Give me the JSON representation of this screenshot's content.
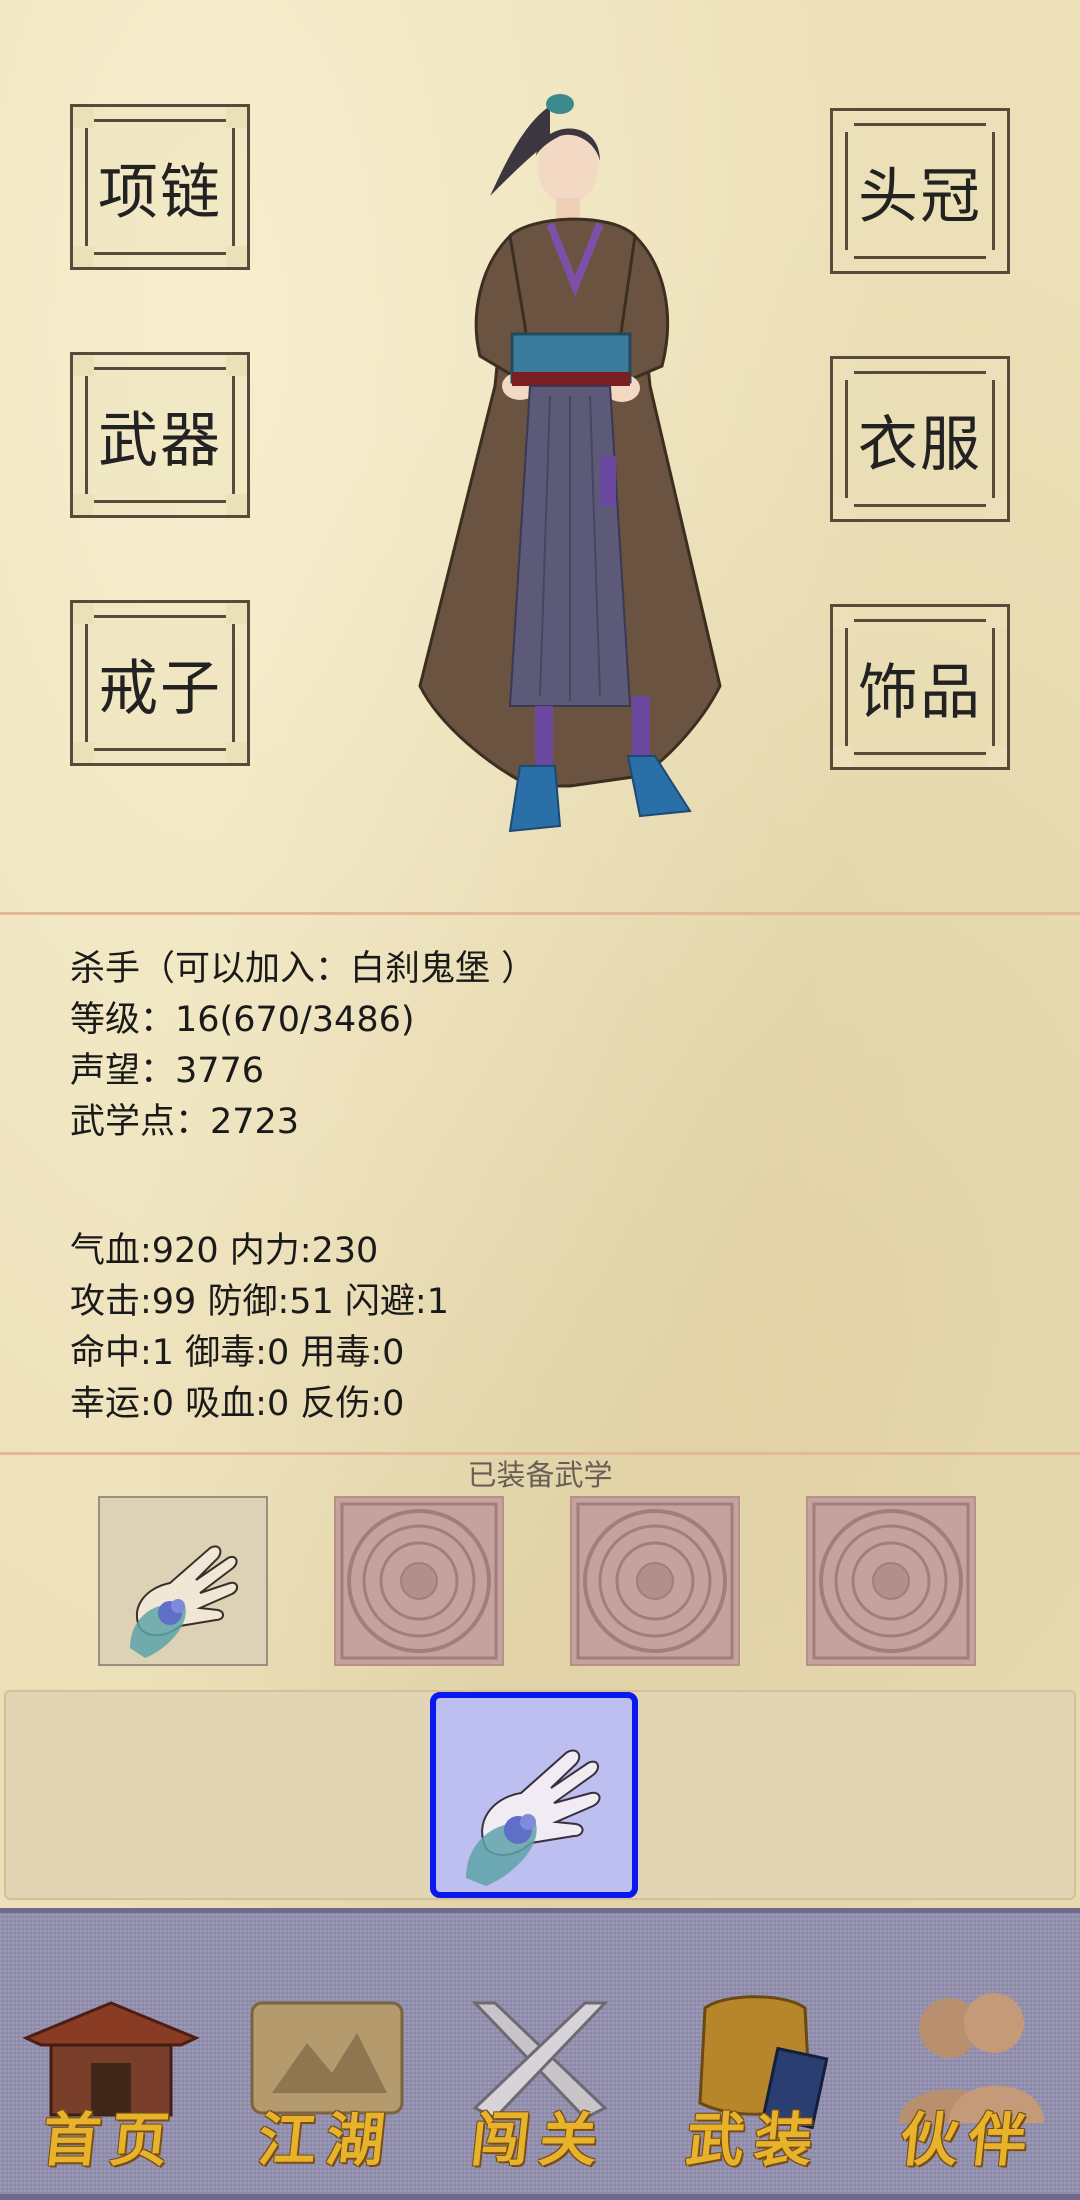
{
  "equipment_slots": {
    "necklace": "项链",
    "hat": "头冠",
    "weapon": "武器",
    "clothes": "衣服",
    "ring": "戒子",
    "accessory": "饰品"
  },
  "character": {
    "role_line": "杀手（可以加入：白刹鬼堡 ）",
    "level_line": "等级：16(670/3486)",
    "prestige_line": "声望：3776",
    "martial_points_line": "武学点：2723"
  },
  "stats": {
    "line1": "气血:920  内力:230",
    "line2": "攻击:99  防御:51  闪避:1",
    "line3": "命中:1  御毒:0  用毒:0",
    "line4": "幸运:0  吸血:0  反伤:0"
  },
  "equipped_skills": {
    "title": "已装备武学",
    "slots": [
      {
        "state": "filled",
        "icon": "open-palm-skill-icon"
      },
      {
        "state": "empty",
        "icon": "aztec-calendar-seal-icon"
      },
      {
        "state": "empty",
        "icon": "aztec-calendar-seal-icon"
      },
      {
        "state": "empty",
        "icon": "aztec-calendar-seal-icon"
      }
    ]
  },
  "skill_tray": {
    "selected_icon": "open-palm-skill-icon",
    "selected_border_color": "#0a18f0"
  },
  "nav": {
    "home": "首页",
    "jianghu": "江湖",
    "stage": "闯关",
    "gear": "武装",
    "partner": "伙伴"
  },
  "colors": {
    "parchment": "#ece0b8",
    "navbar": "#9390b0",
    "nav_label_gold": "#e8b32c",
    "divider": "#e3b894"
  }
}
